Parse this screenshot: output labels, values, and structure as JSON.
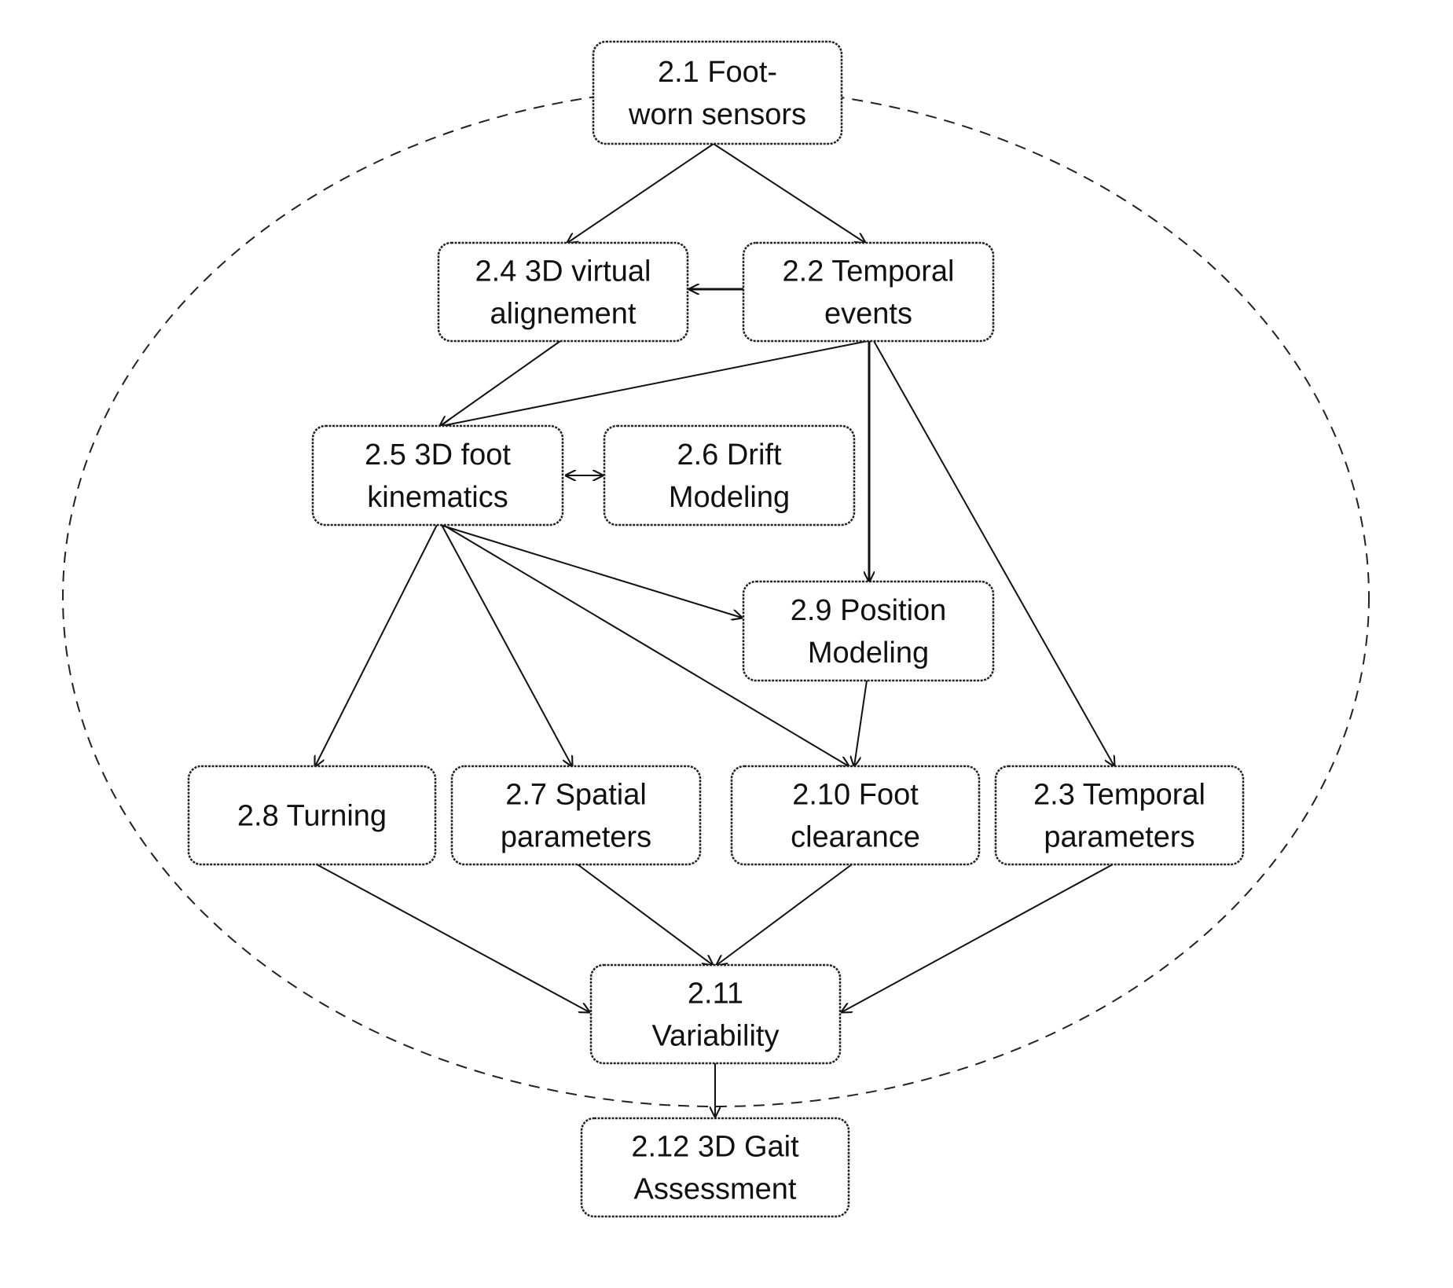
{
  "diagram": {
    "boundary": {
      "style": "dashed-ellipse",
      "encloses": [
        "2.1",
        "2.2",
        "2.3",
        "2.4",
        "2.5",
        "2.6",
        "2.7",
        "2.8",
        "2.9",
        "2.10",
        "2.11"
      ]
    },
    "nodes": [
      {
        "id": "2.1",
        "lines": [
          "2.1 Foot-",
          "worn sensors"
        ]
      },
      {
        "id": "2.4",
        "lines": [
          "2.4 3D virtual",
          "alignement"
        ]
      },
      {
        "id": "2.2",
        "lines": [
          "2.2 Temporal",
          "events"
        ]
      },
      {
        "id": "2.5",
        "lines": [
          "2.5 3D foot",
          "kinematics"
        ]
      },
      {
        "id": "2.6",
        "lines": [
          "2.6 Drift",
          "Modeling"
        ]
      },
      {
        "id": "2.9",
        "lines": [
          "2.9 Position",
          "Modeling"
        ]
      },
      {
        "id": "2.8",
        "lines": [
          "2.8 Turning"
        ]
      },
      {
        "id": "2.7",
        "lines": [
          "2.7 Spatial",
          "parameters"
        ]
      },
      {
        "id": "2.10",
        "lines": [
          "2.10 Foot",
          "clearance"
        ]
      },
      {
        "id": "2.3",
        "lines": [
          "2.3 Temporal",
          "parameters"
        ]
      },
      {
        "id": "2.11",
        "lines": [
          "2.11",
          "Variability"
        ]
      },
      {
        "id": "2.12",
        "lines": [
          "2.12 3D Gait",
          "Assessment"
        ]
      }
    ],
    "edges": [
      {
        "from": "2.1",
        "to": "2.4"
      },
      {
        "from": "2.1",
        "to": "2.2"
      },
      {
        "from": "2.2",
        "to": "2.4"
      },
      {
        "from": "2.4",
        "to": "2.5"
      },
      {
        "from": "2.2",
        "to": "2.5"
      },
      {
        "from": "2.2",
        "to": "2.9"
      },
      {
        "from": "2.2",
        "to": "2.3"
      },
      {
        "from": "2.5",
        "to": "2.6",
        "bidirectional": true
      },
      {
        "from": "2.5",
        "to": "2.9"
      },
      {
        "from": "2.5",
        "to": "2.8"
      },
      {
        "from": "2.5",
        "to": "2.7"
      },
      {
        "from": "2.5",
        "to": "2.10"
      },
      {
        "from": "2.9",
        "to": "2.10"
      },
      {
        "from": "2.8",
        "to": "2.11"
      },
      {
        "from": "2.7",
        "to": "2.11"
      },
      {
        "from": "2.10",
        "to": "2.11"
      },
      {
        "from": "2.3",
        "to": "2.11"
      },
      {
        "from": "2.11",
        "to": "2.12"
      }
    ]
  }
}
